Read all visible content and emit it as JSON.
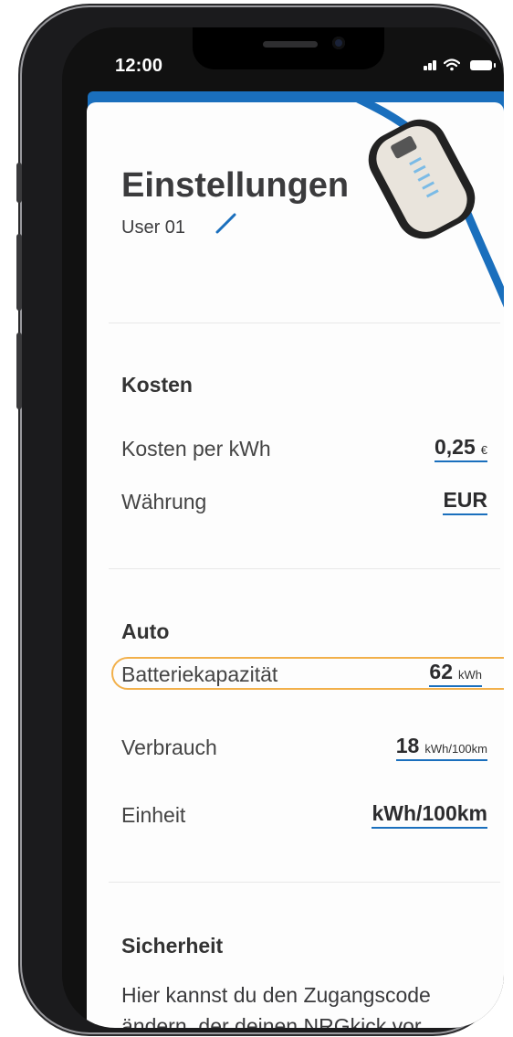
{
  "status_bar": {
    "time": "12:00"
  },
  "header": {
    "title": "Einstellungen",
    "user": "User 01"
  },
  "sections": {
    "kosten": {
      "heading": "Kosten",
      "rows": [
        {
          "label": "Kosten per kWh",
          "value": "0,25",
          "unit": "€"
        },
        {
          "label": "Währung",
          "value": "EUR",
          "unit": ""
        }
      ]
    },
    "auto": {
      "heading": "Auto",
      "rows": [
        {
          "label": "Batteriekapazität",
          "value": "62",
          "unit": "kWh"
        },
        {
          "label": "Verbrauch",
          "value": "18",
          "unit": "kWh/100km"
        },
        {
          "label": "Einheit",
          "value": "kWh/100km",
          "unit": ""
        }
      ]
    },
    "sicherheit": {
      "heading": "Sicherheit",
      "text": "Hier kannst du den Zugangscode ändern, der deinen NRGkick vor"
    }
  },
  "colors": {
    "accent": "#1a6fbd",
    "highlight": "#f2b04a",
    "text": "#3b3b3d"
  },
  "icons": {
    "edit": "pencil-icon",
    "signal": "signal-icon",
    "wifi": "wifi-icon",
    "battery": "battery-icon"
  }
}
